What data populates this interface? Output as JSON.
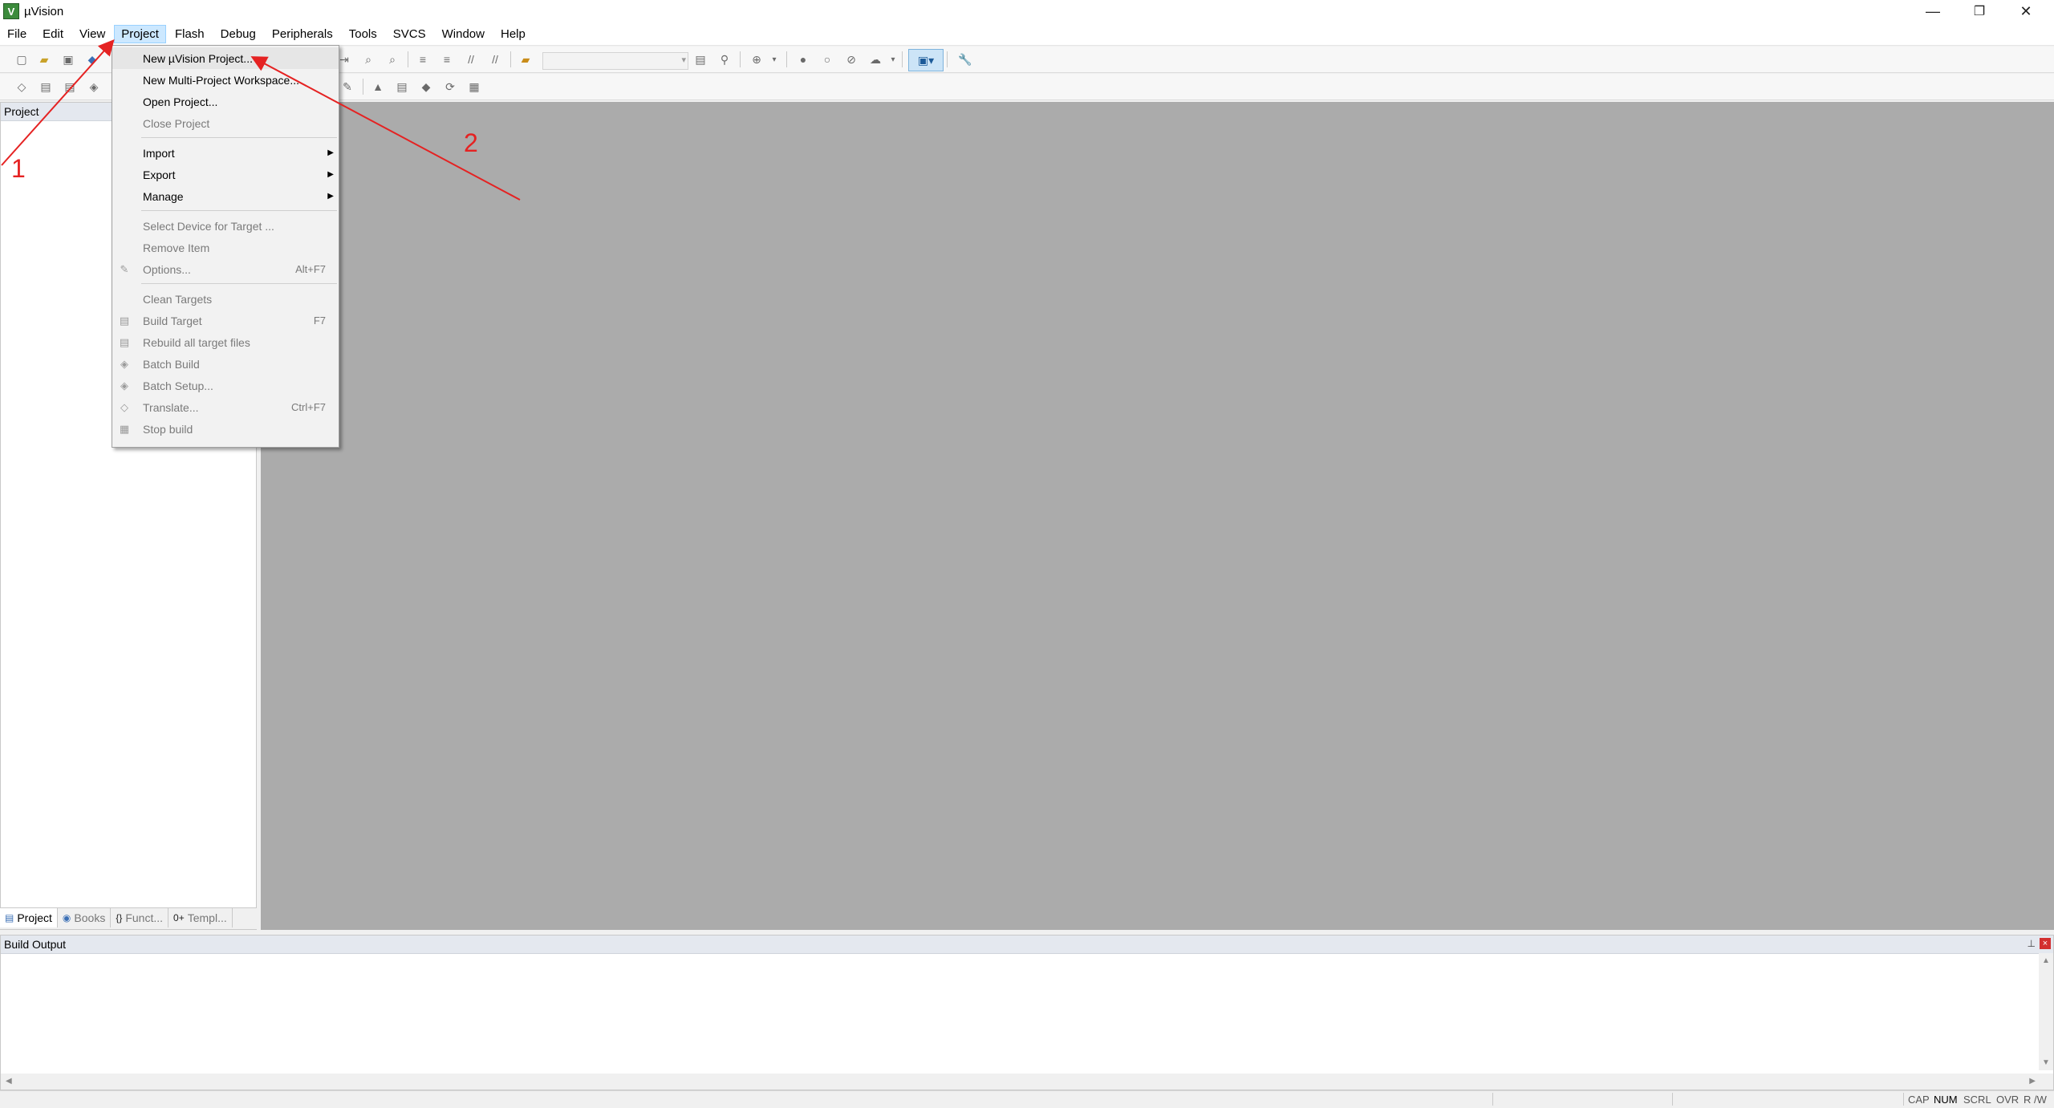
{
  "window": {
    "title": "µVision",
    "icon_letter": "V",
    "minimize": "—",
    "restore": "❐",
    "close": "✕"
  },
  "menubar": {
    "items": [
      "File",
      "Edit",
      "View",
      "Project",
      "Flash",
      "Debug",
      "Peripherals",
      "Tools",
      "SVCS",
      "Window",
      "Help"
    ],
    "active": "Project"
  },
  "project_panel": {
    "title": "Project",
    "tabs": [
      {
        "icon": "▤",
        "label": "Project"
      },
      {
        "icon": "◉",
        "label": "Books"
      },
      {
        "icon": "{}",
        "label": "Funct..."
      },
      {
        "icon": "0+",
        "label": "Templ..."
      }
    ]
  },
  "build_output": {
    "title": "Build Output",
    "pin": "📌",
    "close": "×"
  },
  "statusbar": {
    "cap": "CAP",
    "num": "NUM",
    "scrl": "SCRL",
    "ovr": "OVR",
    "rw": "R /W"
  },
  "project_menu": {
    "items": [
      {
        "label": "New µVision Project...",
        "shortcut": "",
        "enabled": true,
        "highlighted": true
      },
      {
        "label": "New Multi-Project Workspace...",
        "shortcut": "",
        "enabled": true
      },
      {
        "label": "Open Project...",
        "shortcut": "",
        "enabled": true
      },
      {
        "label": "Close Project",
        "shortcut": "",
        "enabled": false
      },
      {
        "label": "Import",
        "submenu": true,
        "enabled": true
      },
      {
        "label": "Export",
        "submenu": true,
        "enabled": true
      },
      {
        "label": "Manage",
        "submenu": true,
        "enabled": true
      },
      {
        "label": "Select Device for Target ...",
        "shortcut": "",
        "enabled": false
      },
      {
        "label": "Remove Item",
        "shortcut": "",
        "enabled": false
      },
      {
        "label": "Options...",
        "shortcut": "Alt+F7",
        "enabled": false,
        "icon": "wand-icon"
      },
      {
        "label": "Clean Targets",
        "shortcut": "",
        "enabled": false
      },
      {
        "label": "Build Target",
        "shortcut": "F7",
        "enabled": false,
        "icon": "build-icon"
      },
      {
        "label": "Rebuild all target files",
        "shortcut": "",
        "enabled": false,
        "icon": "rebuild-icon"
      },
      {
        "label": "Batch Build",
        "shortcut": "",
        "enabled": false,
        "icon": "batch-build-icon"
      },
      {
        "label": "Batch Setup...",
        "shortcut": "",
        "enabled": false,
        "icon": "batch-setup-icon"
      },
      {
        "label": "Translate...",
        "shortcut": "Ctrl+F7",
        "enabled": false,
        "icon": "translate-icon"
      },
      {
        "label": "Stop build",
        "shortcut": "",
        "enabled": false,
        "icon": "stop-build-icon"
      }
    ]
  },
  "annotations": {
    "label_1": "1",
    "label_2": "2",
    "color": "#e52222"
  }
}
